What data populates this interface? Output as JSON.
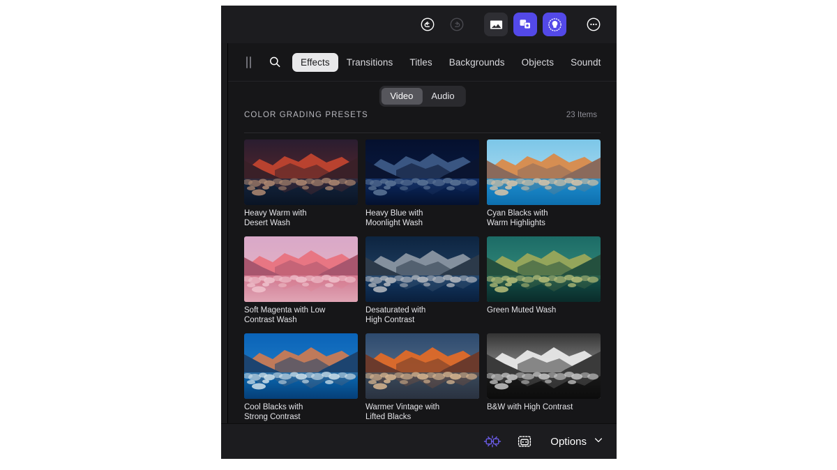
{
  "toolbar": {
    "icons": [
      {
        "name": "undo-icon",
        "label": "Undo",
        "state": "enabled"
      },
      {
        "name": "redo-icon",
        "label": "Redo",
        "state": "disabled"
      },
      {
        "name": "media-icon",
        "label": "Media",
        "state": "boxed"
      },
      {
        "name": "effects-icon",
        "label": "Effects",
        "state": "accent"
      },
      {
        "name": "magic-icon",
        "label": "AI Enhance",
        "state": "accent"
      },
      {
        "name": "more-icon",
        "label": "More options",
        "state": "enabled"
      }
    ],
    "accent_color": "#5349e8"
  },
  "browser": {
    "drag_handle_label": "Resize panel",
    "search_placeholder": "Search",
    "tabs": [
      {
        "label": "Effects",
        "active": true
      },
      {
        "label": "Transitions",
        "active": false
      },
      {
        "label": "Titles",
        "active": false
      },
      {
        "label": "Backgrounds",
        "active": false
      },
      {
        "label": "Objects",
        "active": false
      },
      {
        "label": "Soundt",
        "active": false
      }
    ],
    "segmented": [
      {
        "label": "Video",
        "active": true
      },
      {
        "label": "Audio",
        "active": false
      }
    ],
    "section_title": "COLOR GRADING PRESETS",
    "item_count": "23 Items",
    "presets": [
      {
        "label": "Heavy Warm with\nDesert Wash",
        "sky_top": "#2a1d30",
        "sky_bot": "#6b2a28",
        "peak": "#c0442f",
        "mountain": "#3a2028",
        "water_top": "#14253f",
        "water_bot": "#0a1424",
        "rock": "#b08a72"
      },
      {
        "label": "Heavy Blue with\nMoonlight Wash",
        "sky_top": "#05102e",
        "sky_bot": "#0b1f4a",
        "peak": "#3d5a86",
        "mountain": "#0a1430",
        "water_top": "#0b2a63",
        "water_bot": "#04112e",
        "rock": "#5d7596"
      },
      {
        "label": "Cyan Blacks with\nWarm Highlights",
        "sky_top": "#7cc6e8",
        "sky_bot": "#bfe3f2",
        "peak": "#d98a4a",
        "mountain": "#8a6a5c",
        "water_top": "#1f8fd0",
        "water_bot": "#0d6fae",
        "rock": "#d9c4a8"
      },
      {
        "label": "Soft Magenta with Low\nContrast Wash",
        "sky_top": "#d9a8c8",
        "sky_bot": "#e8b6c2",
        "peak": "#e8737f",
        "mountain": "#a8566e",
        "water_top": "#d07a92",
        "water_bot": "#e0a4b4",
        "rock": "#f0c2cc"
      },
      {
        "label": "Desaturated with\nHigh Contrast",
        "sky_top": "#0d2440",
        "sky_bot": "#2a4f74",
        "peak": "#8a96a2",
        "mountain": "#2c3a4a",
        "water_top": "#123a66",
        "water_bot": "#0a1f3c",
        "rock": "#b8bcc2"
      },
      {
        "label": "Green Muted Wash",
        "sky_top": "#1c6b66",
        "sky_bot": "#3f9a84",
        "peak": "#9aa85a",
        "mountain": "#24503e",
        "water_top": "#14514a",
        "water_bot": "#0a2c2a",
        "rock": "#b8c07a"
      },
      {
        "label": "Cool Blacks with\nStrong Contrast",
        "sky_top": "#0a63b8",
        "sky_bot": "#2a88cc",
        "peak": "#c87a54",
        "mountain": "#1c4470",
        "water_top": "#0a6ab4",
        "water_bot": "#053f78",
        "rock": "#cfe0ea"
      },
      {
        "label": "Warmer Vintage with\nLifted Blacks",
        "sky_top": "#2d4a6e",
        "sky_bot": "#6a7d94",
        "peak": "#e06a28",
        "mountain": "#6b3a2c",
        "water_top": "#3a4a5c",
        "water_bot": "#2a3240",
        "rock": "#d8b690"
      },
      {
        "label": "B&W with High Contrast",
        "sky_top": "#333333",
        "sky_bot": "#d0d0d0",
        "peak": "#e8e8e8",
        "mountain": "#3a3a3a",
        "water_top": "#1a1a1a",
        "water_bot": "#0c0c0c",
        "rock": "#c8c8c8"
      }
    ]
  },
  "bottom": {
    "icons": [
      {
        "name": "ai-enhance-icon",
        "label": "AI Enhance",
        "accent": true
      },
      {
        "name": "ai-robot-icon",
        "label": "AI Assistant",
        "accent": false
      }
    ],
    "options_label": "Options"
  }
}
